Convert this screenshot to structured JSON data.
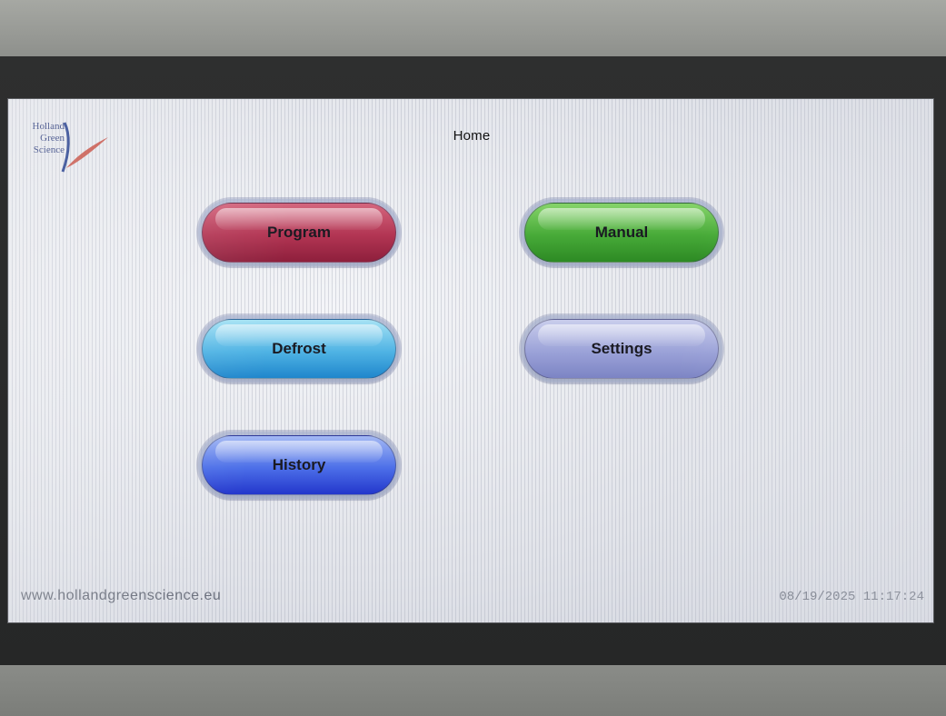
{
  "header": {
    "title": "Home",
    "logo": {
      "lines": [
        "Holland",
        "Green",
        "Science"
      ],
      "icon": "leaf-logo-icon"
    }
  },
  "buttons": {
    "program": {
      "label": "Program",
      "color": "#b23553"
    },
    "manual": {
      "label": "Manual",
      "color": "#47aa38"
    },
    "defrost": {
      "label": "Defrost",
      "color": "#4fb3e4"
    },
    "settings": {
      "label": "Settings",
      "color": "#9ba2d8"
    },
    "history": {
      "label": "History",
      "color": "#4c6fe8"
    }
  },
  "footer": {
    "url": "www.hollandgreenscience.eu",
    "datetime": "08/19/2025 11:17:24"
  }
}
